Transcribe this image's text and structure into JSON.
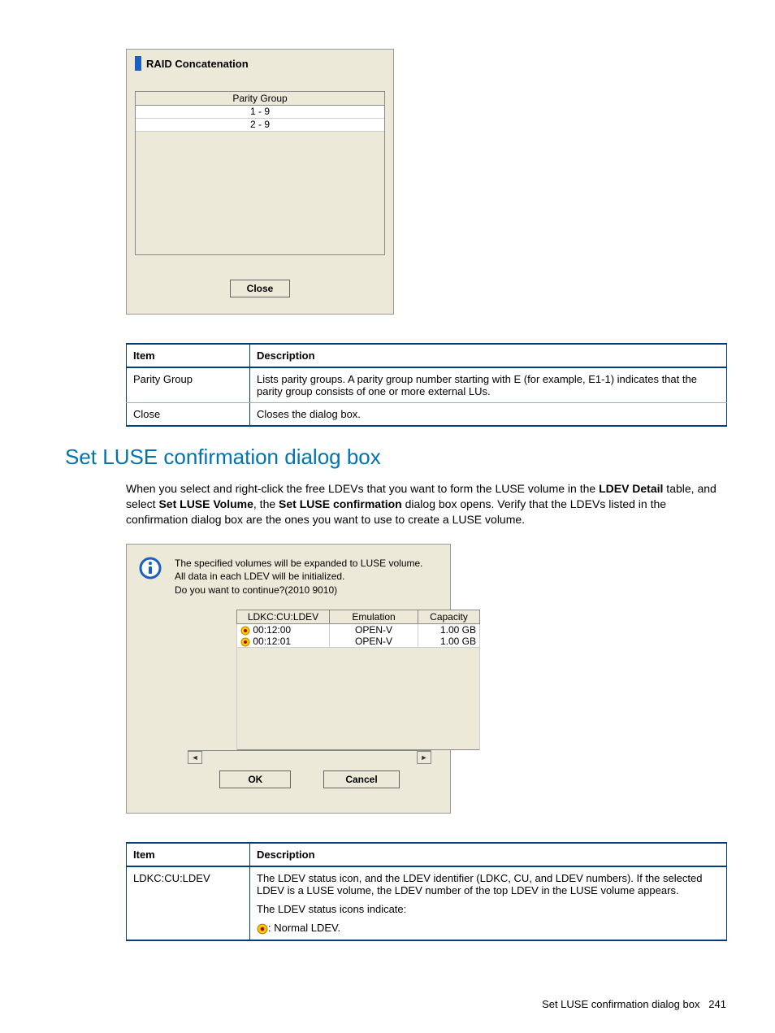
{
  "dialog1": {
    "title": "RAID Concatenation",
    "column": "Parity Group",
    "rows": [
      "1 - 9",
      "2 - 9"
    ],
    "close": "Close"
  },
  "table1": {
    "headers": [
      "Item",
      "Description"
    ],
    "rows": [
      {
        "item": "Parity Group",
        "desc": "Lists parity groups. A parity group number starting with E (for example, E1-1) indicates that the parity group consists of one or more external LUs."
      },
      {
        "item": "Close",
        "desc": "Closes the dialog box."
      }
    ]
  },
  "section": {
    "heading": "Set LUSE confirmation dialog box",
    "para_parts": [
      "When you select and right-click the free LDEVs that you want to form the LUSE volume in the ",
      "LDEV Detail",
      " table, and select ",
      "Set LUSE Volume",
      ", the ",
      "Set LUSE confirmation",
      " dialog box opens. Verify that the LDEVs listed in the confirmation dialog box are the ones you want to use to create a LUSE volume."
    ]
  },
  "dialog2": {
    "msg_l1": "The specified volumes will be expanded to LUSE volume.",
    "msg_l2": "All data in each LDEV will be initialized.",
    "msg_l3": "Do you want to continue?(2010 9010)",
    "cols": [
      "LDKC:CU:LDEV",
      "Emulation",
      "Capacity"
    ],
    "rows": [
      {
        "id": "00:12:00",
        "emu": "OPEN-V",
        "cap": "1.00 GB"
      },
      {
        "id": "00:12:01",
        "emu": "OPEN-V",
        "cap": "1.00 GB"
      }
    ],
    "ok": "OK",
    "cancel": "Cancel"
  },
  "table2": {
    "headers": [
      "Item",
      "Description"
    ],
    "row_item": "LDKC:CU:LDEV",
    "row_desc_l1": "The LDEV status icon, and the LDEV identifier (LDKC, CU, and LDEV numbers). If the selected LDEV is a LUSE volume, the LDEV number of the top LDEV in the LUSE volume appears.",
    "row_desc_l2": "The LDEV status icons indicate:",
    "row_desc_l3": ": Normal LDEV."
  },
  "footer": {
    "text": "Set LUSE confirmation dialog box",
    "page": "241"
  }
}
